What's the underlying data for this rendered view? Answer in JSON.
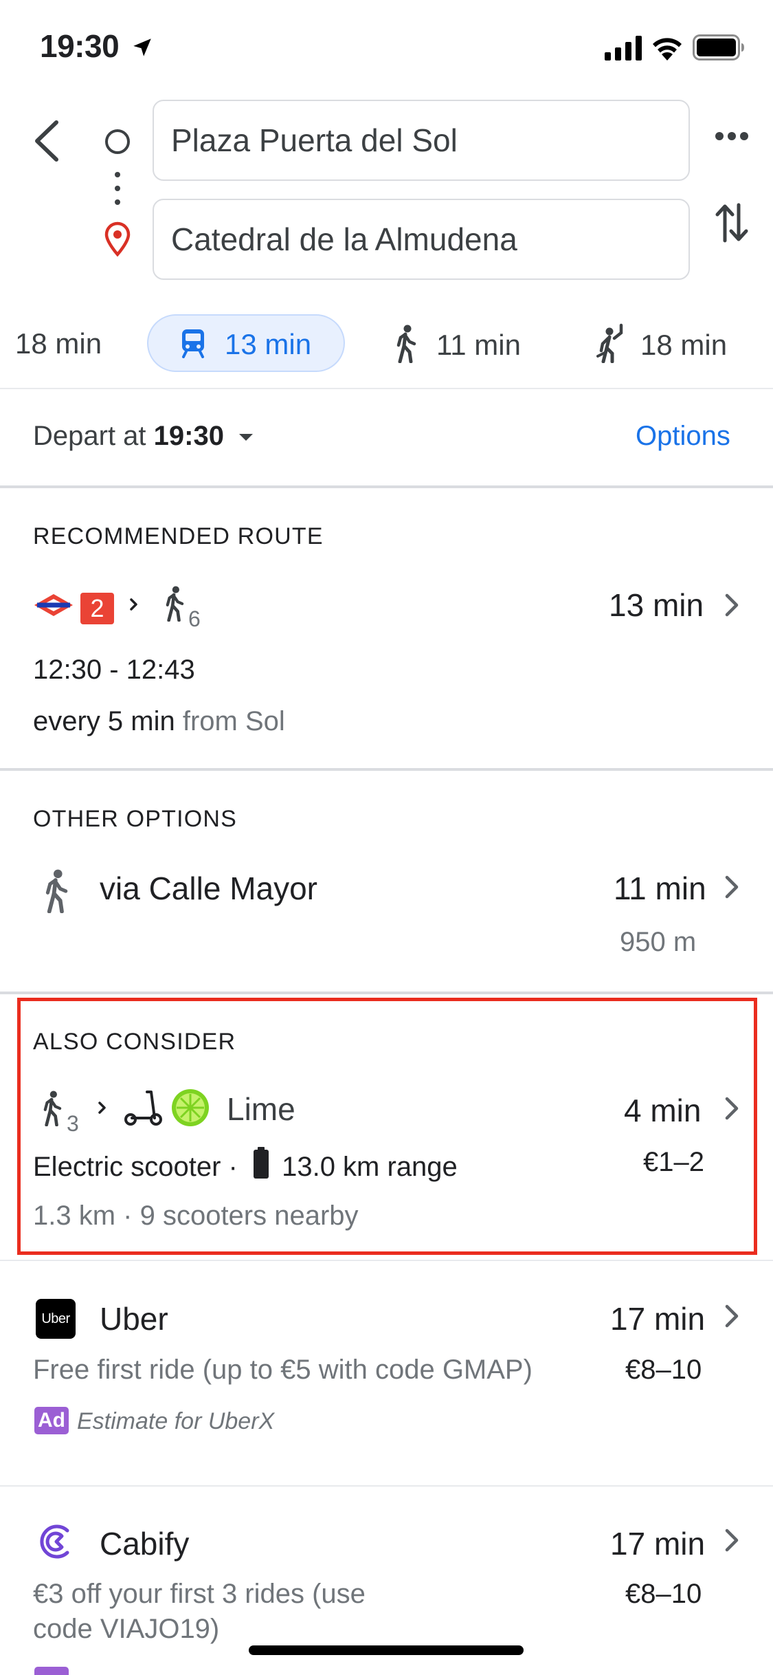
{
  "status_bar": {
    "time": "19:30",
    "icons": [
      "location-arrow-icon",
      "signal-icon",
      "wifi-icon",
      "battery-icon"
    ]
  },
  "search": {
    "origin_value": "Plaza Puerta del Sol",
    "destination_value": "Catedral de la Almudena"
  },
  "modes": [
    {
      "icon": "car-icon",
      "label": "18 min",
      "selected": false
    },
    {
      "icon": "train-icon",
      "label": "13 min",
      "selected": true
    },
    {
      "icon": "walk-icon",
      "label": "11 min",
      "selected": false
    },
    {
      "icon": "ride-hail-icon",
      "label": "18 min",
      "selected": false
    }
  ],
  "depart": {
    "prefix": "Depart at ",
    "time": "19:30",
    "options_label": "Options"
  },
  "recommended": {
    "section_title": "RECOMMENDED ROUTE",
    "line_number": "2",
    "walk_minutes": "6",
    "duration": "13 min",
    "time_range": "12:30 - 12:43",
    "frequency": "every 5 min",
    "from_text": "from Sol"
  },
  "other_options": {
    "section_title": "OTHER OPTIONS",
    "route_label": "via Calle Mayor",
    "duration": "11 min",
    "distance": "950 m"
  },
  "also_consider": {
    "section_title": "ALSO CONSIDER",
    "walk_minutes": "3",
    "provider": "Lime",
    "duration": "4 min",
    "vehicle_text": "Electric scooter · ",
    "range_text": "13.0 km range",
    "price": "€1–2",
    "details": "1.3 km · 9 scooters nearby"
  },
  "uber": {
    "logo_text": "Uber",
    "name": "Uber",
    "duration": "17 min",
    "promo": "Free first ride (up to €5 with code GMAP)",
    "price": "€8–10",
    "ad_label": "Ad",
    "estimate": "Estimate for UberX"
  },
  "cabify": {
    "name": "Cabify",
    "duration": "17 min",
    "promo_line1": "€3 off your first 3 rides (use",
    "promo_line2": "code VIAJO19)",
    "price": "€8–10"
  },
  "colors": {
    "accent_blue": "#1a73e8",
    "selected_pill": "#e8f0fe",
    "highlight_red": "#ea2d1f",
    "metro_red": "#ea4335",
    "lime_green": "#7ed321",
    "ad_purple": "#9b5fd4",
    "cabify_purple": "#7145d6"
  }
}
